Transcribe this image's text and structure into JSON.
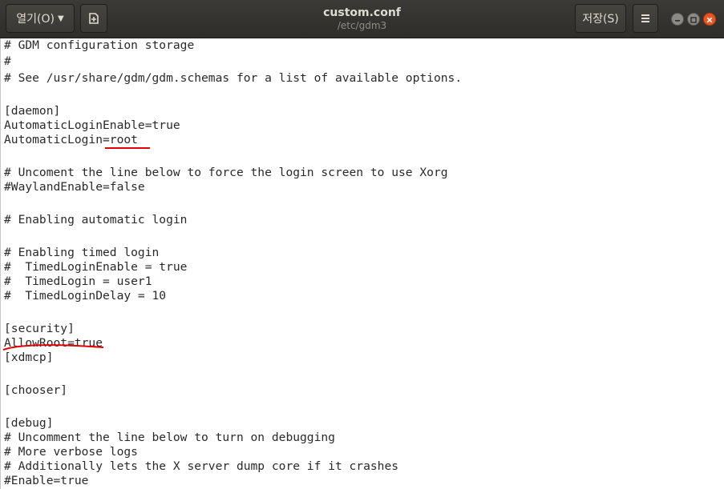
{
  "header": {
    "open_label": "열기(O)",
    "save_label": "저장(S)",
    "title": "custom.conf",
    "subtitle": "/etc/gdm3",
    "icons": {
      "open_caret": "chevron-down-icon",
      "new_document": "new-document-icon",
      "menu": "hamburger-menu-icon",
      "minimize": "minimize-icon",
      "maximize": "maximize-icon",
      "close": "close-icon"
    },
    "accent_color": "#e95420"
  },
  "editor": {
    "lines": [
      "# GDM configuration storage",
      "#",
      "# See /usr/share/gdm/gdm.schemas for a list of available options.",
      "",
      "[daemon]",
      "AutomaticLoginEnable=true",
      "AutomaticLogin=root",
      "",
      "# Uncoment the line below to force the login screen to use Xorg",
      "#WaylandEnable=false",
      "",
      "# Enabling automatic login",
      "",
      "# Enabling timed login",
      "#  TimedLoginEnable = true",
      "#  TimedLogin = user1",
      "#  TimedLoginDelay = 10",
      "",
      "[security]",
      "AllowRoot=true",
      "[xdmcp]",
      "",
      "[chooser]",
      "",
      "[debug]",
      "# Uncomment the line below to turn on debugging",
      "# More verbose logs",
      "# Additionally lets the X server dump core if it crashes",
      "#Enable=true"
    ],
    "annotation_color": "#e00000"
  }
}
